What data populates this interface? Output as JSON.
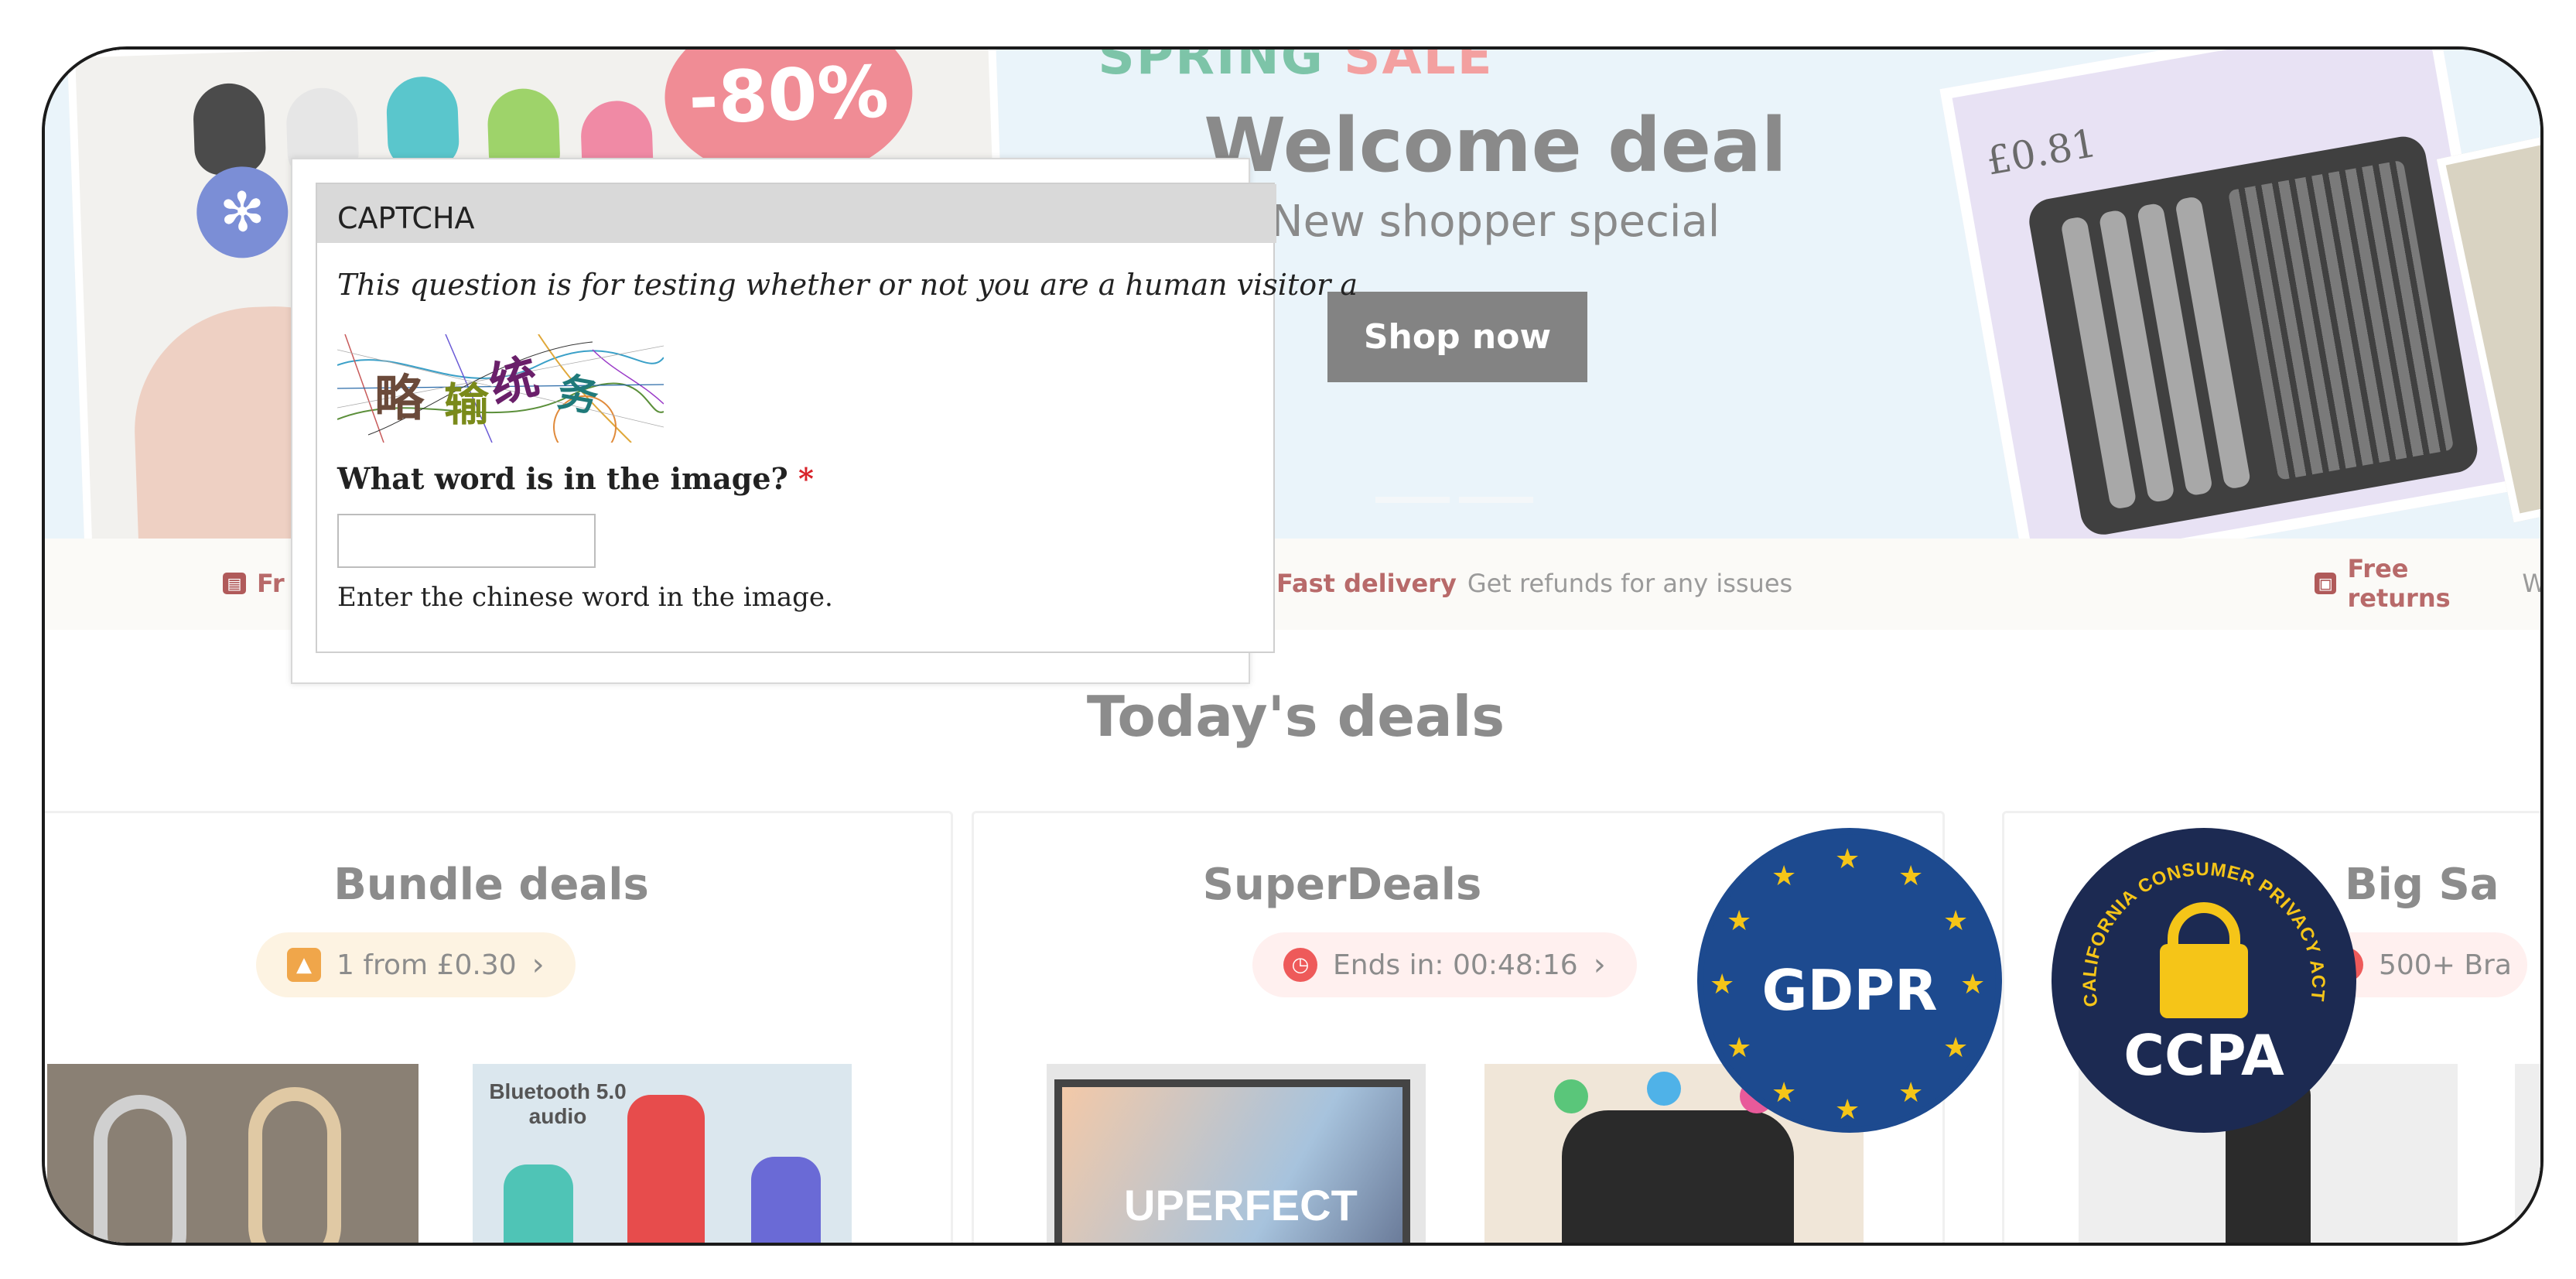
{
  "hero": {
    "sale_word1": "SPRING",
    "sale_word2": "SALE",
    "discount": "-80%",
    "title": "Welcome deal",
    "subtitle": "New shopper special",
    "cta_label": "Shop now",
    "product_price": "£0.81",
    "bluetooth_digit": "5"
  },
  "benefits": [
    {
      "bold": "Fr",
      "text": ""
    },
    {
      "bold": "Fast delivery",
      "text": "Get refunds for any issues"
    },
    {
      "bold": "Free returns",
      "text": "W"
    }
  ],
  "deals": {
    "section_title": "Today's deals",
    "cards": [
      {
        "title": "Bundle deals",
        "pill": "1 from £0.30"
      },
      {
        "title": "SuperDeals",
        "pill": "Ends in: 00:48:16"
      },
      {
        "title": "Big Sa",
        "pill": "500+ Bra"
      }
    ],
    "products": [
      "Bluetooth 5.0 audio",
      "UPERFECT"
    ]
  },
  "captcha": {
    "legend": "CAPTCHA",
    "description": "This question is for testing whether or not you are a human visitor a",
    "image_chars": [
      "略",
      "输",
      "统",
      "务"
    ],
    "question": "What word is in the image?",
    "required_marker": "*",
    "input_value": "",
    "hint": "Enter the chinese word in the image."
  },
  "badges": {
    "gdpr": "GDPR",
    "ccpa": "CCPA",
    "ccpa_ring": "CALIFORNIA CONSUMER PRIVACY ACT"
  },
  "colors": {
    "captcha_required": "#d8232a",
    "gdpr_blue": "#1d4a8f",
    "ccpa_navy": "#1c2a52",
    "badge_gold": "#f5c518",
    "cta_bg": "#838383"
  }
}
